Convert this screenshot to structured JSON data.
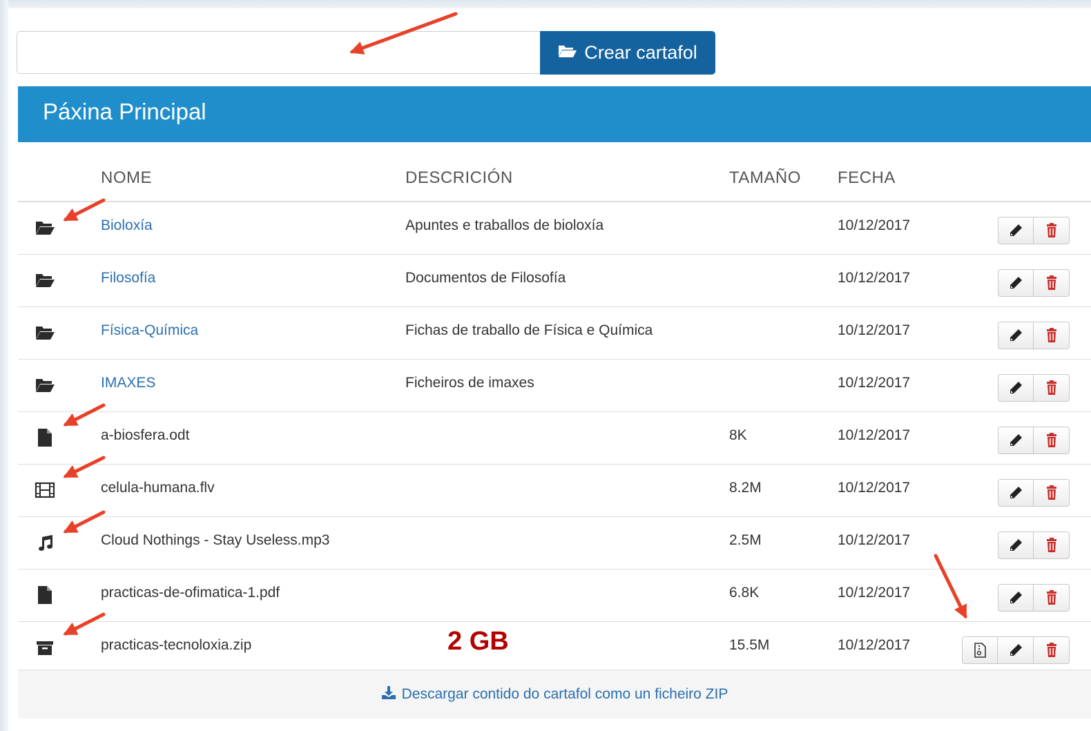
{
  "toolbar": {
    "new_folder_value": "",
    "create_label": "Crear cartafol"
  },
  "panel": {
    "title": "Páxina Principal"
  },
  "table": {
    "headers": {
      "name": "NOME",
      "description": "DESCRICIÓN",
      "size": "TAMAÑO",
      "date": "FECHA"
    },
    "rows": [
      {
        "icon": "folder-open-icon",
        "name": "Bioloxía",
        "description": "Apuntes e traballos de bioloxía",
        "size": "",
        "date": "10/12/2017"
      },
      {
        "icon": "folder-open-icon",
        "name": "Filosofía",
        "description": "Documentos de Filosofía",
        "size": "",
        "date": "10/12/2017"
      },
      {
        "icon": "folder-open-icon",
        "name": "Física-Química",
        "description": "Fichas de traballo de Física e Química",
        "size": "",
        "date": "10/12/2017"
      },
      {
        "icon": "folder-open-icon",
        "name": "IMAXES",
        "description": "Ficheiros de imaxes",
        "size": "",
        "date": "10/12/2017"
      },
      {
        "icon": "file-icon",
        "name": "a-biosfera.odt",
        "description": "",
        "size": "8K",
        "date": "10/12/2017"
      },
      {
        "icon": "film-icon",
        "name": "celula-humana.flv",
        "description": "",
        "size": "8.2M",
        "date": "10/12/2017"
      },
      {
        "icon": "music-icon",
        "name": "Cloud Nothings - Stay Useless.mp3",
        "description": "",
        "size": "2.5M",
        "date": "10/12/2017"
      },
      {
        "icon": "file-icon",
        "name": "practicas-de-ofimatica-1.pdf",
        "description": "",
        "size": "6.8K",
        "date": "10/12/2017"
      },
      {
        "icon": "archive-icon",
        "name": "practicas-tecnoloxia.zip",
        "description": "",
        "size": "15.5M",
        "date": "10/12/2017"
      }
    ]
  },
  "annotation": {
    "size_note": "2 GB"
  },
  "footer": {
    "download_label": "Descargar contido do cartafol como un ficheiro ZIP"
  },
  "colors": {
    "primary": "#14629e",
    "panel": "#1f8ecb",
    "link": "#2a6faf",
    "danger": "#c9302c",
    "annotation": "#e8412a"
  }
}
